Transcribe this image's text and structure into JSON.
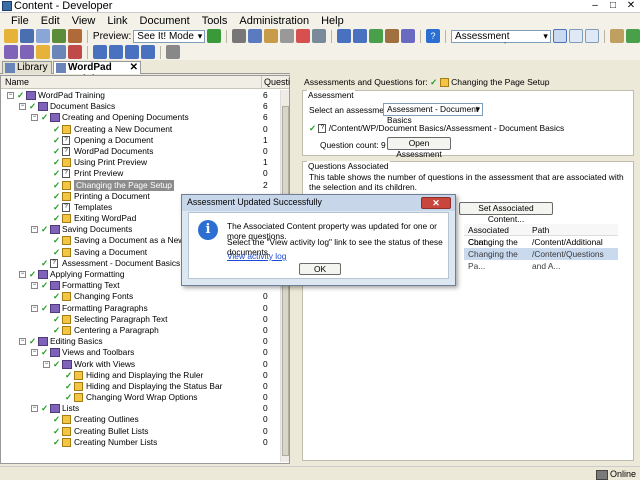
{
  "window": {
    "title": "Content - Developer",
    "controls": [
      "–",
      "□",
      "✕"
    ]
  },
  "menu": [
    "File",
    "Edit",
    "View",
    "Link",
    "Document",
    "Tools",
    "Administration",
    "Help"
  ],
  "toolbar": {
    "preview_label": "Preview:",
    "preview_mode": "See It! Mode",
    "view_select": "Assessment coverage view"
  },
  "tabs": [
    {
      "label": "Library",
      "active": false
    },
    {
      "label": "WordPad Training",
      "active": true,
      "close": "✕"
    }
  ],
  "tree": {
    "col_name": "Name",
    "col_count": "Questi",
    "rows": [
      {
        "indent": 0,
        "type": "book",
        "label": "WordPad Training",
        "count": "6"
      },
      {
        "indent": 1,
        "type": "book",
        "label": "Document Basics",
        "count": "6"
      },
      {
        "indent": 2,
        "type": "book",
        "label": "Creating and Opening Documents",
        "count": "6"
      },
      {
        "indent": 3,
        "type": "topic",
        "label": "Creating a New Document",
        "count": "0"
      },
      {
        "indent": 3,
        "type": "question",
        "label": "Opening a Document",
        "count": "1"
      },
      {
        "indent": 3,
        "type": "question",
        "label": "WordPad Documents",
        "count": "0"
      },
      {
        "indent": 3,
        "type": "topic",
        "label": "Using Print Preview",
        "count": "1"
      },
      {
        "indent": 3,
        "type": "question",
        "label": "Print Preview",
        "count": "0"
      },
      {
        "indent": 3,
        "type": "topic",
        "label": "Changing the Page Setup",
        "count": "2",
        "selected": true
      },
      {
        "indent": 3,
        "type": "topic",
        "label": "Printing a Document",
        "count": ""
      },
      {
        "indent": 3,
        "type": "question",
        "label": "Templates",
        "count": ""
      },
      {
        "indent": 3,
        "type": "topic",
        "label": "Exiting WordPad",
        "count": ""
      },
      {
        "indent": 2,
        "type": "book",
        "label": "Saving Documents",
        "count": ""
      },
      {
        "indent": 3,
        "type": "topic",
        "label": "Saving a Document as a New File",
        "count": ""
      },
      {
        "indent": 3,
        "type": "topic",
        "label": "Saving a Document",
        "count": ""
      },
      {
        "indent": 2,
        "type": "question",
        "label": "Assessment - Document Basics",
        "count": ""
      },
      {
        "indent": 1,
        "type": "book",
        "label": "Applying Formatting",
        "count": ""
      },
      {
        "indent": 2,
        "type": "book",
        "label": "Formatting Text",
        "count": ""
      },
      {
        "indent": 3,
        "type": "topic",
        "label": "Changing Fonts",
        "count": "0"
      },
      {
        "indent": 2,
        "type": "book",
        "label": "Formatting Paragraphs",
        "count": "0"
      },
      {
        "indent": 3,
        "type": "topic",
        "label": "Selecting Paragraph Text",
        "count": "0"
      },
      {
        "indent": 3,
        "type": "topic",
        "label": "Centering a Paragraph",
        "count": "0"
      },
      {
        "indent": 1,
        "type": "book",
        "label": "Editing Basics",
        "count": "0"
      },
      {
        "indent": 2,
        "type": "book",
        "label": "Views and Toolbars",
        "count": "0"
      },
      {
        "indent": 3,
        "type": "book",
        "label": "Work with Views",
        "count": "0"
      },
      {
        "indent": 4,
        "type": "topic",
        "label": "Hiding and Displaying the Ruler",
        "count": "0"
      },
      {
        "indent": 4,
        "type": "topic",
        "label": "Hiding and Displaying the Status Bar",
        "count": "0"
      },
      {
        "indent": 4,
        "type": "topic",
        "label": "Changing Word Wrap Options",
        "count": "0"
      },
      {
        "indent": 2,
        "type": "book",
        "label": "Lists",
        "count": "0"
      },
      {
        "indent": 3,
        "type": "topic",
        "label": "Creating Outlines",
        "count": "0"
      },
      {
        "indent": 3,
        "type": "topic",
        "label": "Creating Bullet Lists",
        "count": "0"
      },
      {
        "indent": 3,
        "type": "topic",
        "label": "Creating Number Lists",
        "count": "0"
      }
    ]
  },
  "right": {
    "header_prefix": "Assessments and Questions for:",
    "header_doc": "Changing the Page Setup",
    "assessment_group": "Assessment",
    "select_label": "Select an assessment:",
    "select_value": "Assessment - Document Basics",
    "path": "/Content/WP/Document Basics/Assessment - Document Basics",
    "question_count": "Question count: 9",
    "open_button": "Open Assessment",
    "questions_group": "Questions Associated",
    "description": "This table shows the number of questions in the assessment that are associated with the selection and its children.",
    "set_button": "Set Associated Content...",
    "table": {
      "headers": [
        "Associated Cont...",
        "Path"
      ],
      "rows": [
        {
          "c1": "Changing the Pa...",
          "c2": "/Content/Additional Topics",
          "selected": false
        },
        {
          "c1": "Changing the Pa...",
          "c2": "/Content/Questions and A...",
          "selected": true
        }
      ]
    }
  },
  "dialog": {
    "title": "Assessment Updated Successfully",
    "close": "✕",
    "icon": "i",
    "line1": "The Associated Content property was updated for one or more questions.",
    "line2": "Select the \"View activity log\" link to see the status of these documents.",
    "link": "View activity log",
    "ok": "OK"
  },
  "status": {
    "online": "Online"
  }
}
